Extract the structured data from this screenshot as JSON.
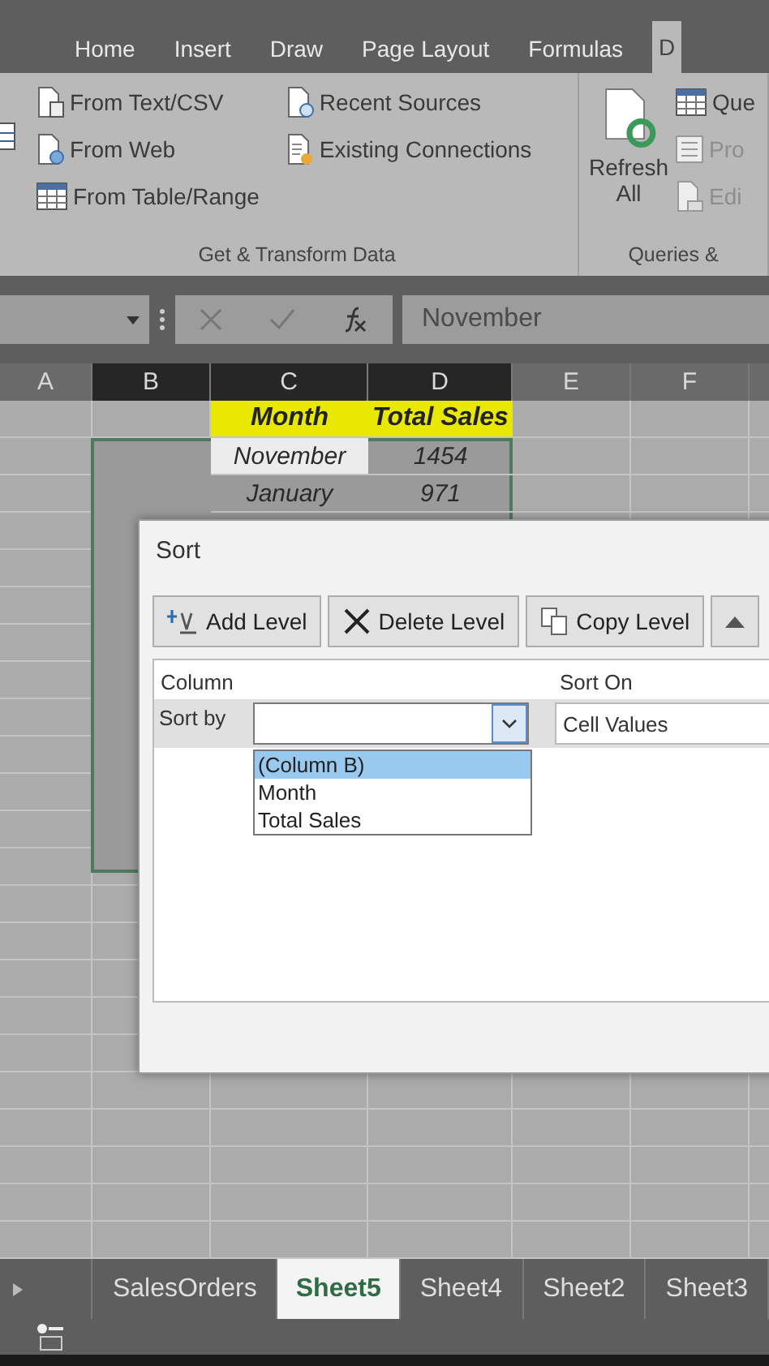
{
  "ribbon_tabs": [
    {
      "label": "Home",
      "selected": false
    },
    {
      "label": "Insert",
      "selected": false
    },
    {
      "label": "Draw",
      "selected": false
    },
    {
      "label": "Page Layout",
      "selected": false
    },
    {
      "label": "Formulas",
      "selected": false
    },
    {
      "label": "D",
      "selected": true
    }
  ],
  "ribbon_groups": [
    {
      "label": "Get & Transform Data",
      "columns": [
        [
          {
            "label": "From Text/CSV",
            "kind": "text-file",
            "disabled": false
          },
          {
            "label": "From Web",
            "kind": "web",
            "disabled": false
          },
          {
            "label": "From Table/Range",
            "kind": "table",
            "disabled": false
          }
        ],
        [
          {
            "label": "Recent Sources",
            "kind": "recent",
            "disabled": false
          },
          {
            "label": "Existing Connections",
            "kind": "connections",
            "disabled": false
          }
        ]
      ]
    },
    {
      "label": "Queries &",
      "big_button": {
        "lines": [
          "Refresh",
          "All"
        ]
      },
      "columns": [
        [
          {
            "label": "Que",
            "kind": "table",
            "disabled": false
          },
          {
            "label": "Pro",
            "kind": "properties",
            "disabled": true
          },
          {
            "label": "Edi",
            "kind": "edit",
            "disabled": true
          }
        ]
      ]
    }
  ],
  "formula_bar": {
    "value": "November"
  },
  "columns": [
    {
      "label": "A",
      "selected": false
    },
    {
      "label": "B",
      "selected": true
    },
    {
      "label": "C",
      "selected": true
    },
    {
      "label": "D",
      "selected": true
    },
    {
      "label": "E",
      "selected": false
    },
    {
      "label": "F",
      "selected": false
    }
  ],
  "header_row": [
    "Month",
    "Total Sales"
  ],
  "data_rows": [
    [
      "November",
      "1454"
    ],
    [
      "January",
      "971"
    ]
  ],
  "sort_dialog": {
    "title": "Sort",
    "buttons": [
      "Add Level",
      "Delete Level",
      "Copy Level"
    ],
    "column_heading": "Column",
    "sort_on_heading": "Sort On",
    "sort_by_label": "Sort by",
    "sort_on_value": "Cell Values",
    "options": [
      {
        "label": "(Column B)",
        "selected": true
      },
      {
        "label": "Month",
        "selected": false
      },
      {
        "label": "Total Sales",
        "selected": false
      }
    ]
  },
  "sheet_tabs": [
    {
      "label": "SalesOrders",
      "selected": false
    },
    {
      "label": "Sheet5",
      "selected": true
    },
    {
      "label": "Sheet4",
      "selected": false
    },
    {
      "label": "Sheet2",
      "selected": false
    },
    {
      "label": "Sheet3",
      "selected": false
    }
  ]
}
